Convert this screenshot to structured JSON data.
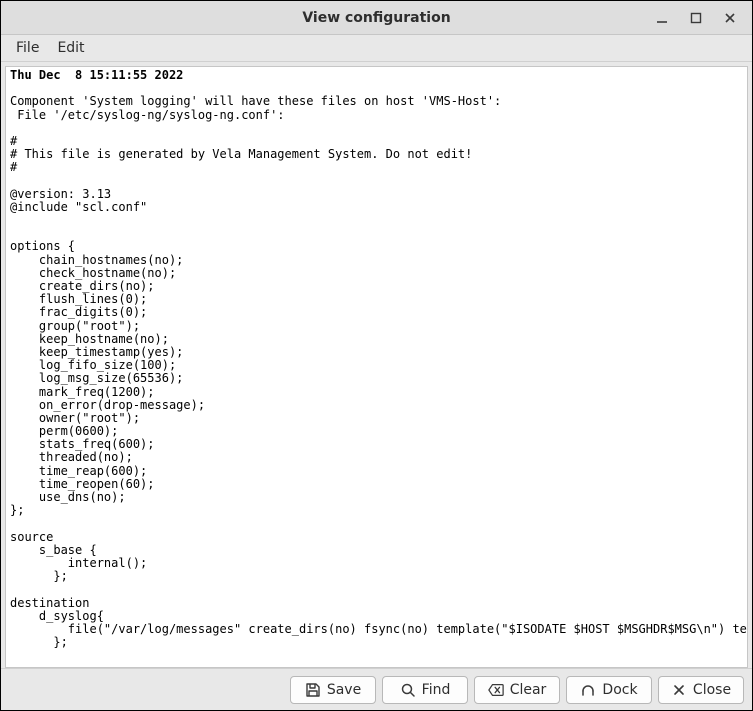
{
  "window": {
    "title": "View configuration"
  },
  "menubar": {
    "file": "File",
    "edit": "Edit"
  },
  "content": {
    "header_line": "Thu Dec  8 15:11:55 2022",
    "body": "\nComponent 'System logging' will have these files on host 'VMS-Host':\n File '/etc/syslog-ng/syslog-ng.conf':\n\n#\n# This file is generated by Vela Management System. Do not edit!\n#\n\n@version: 3.13\n@include \"scl.conf\"\n\n\noptions {\n    chain_hostnames(no);\n    check_hostname(no);\n    create_dirs(no);\n    flush_lines(0);\n    frac_digits(0);\n    group(\"root\");\n    keep_hostname(no);\n    keep_timestamp(yes);\n    log_fifo_size(100);\n    log_msg_size(65536);\n    mark_freq(1200);\n    on_error(drop-message);\n    owner(\"root\");\n    perm(0600);\n    stats_freq(600);\n    threaded(no);\n    time_reap(600);\n    time_reopen(60);\n    use_dns(no);\n};\n\nsource\n    s_base {\n        internal();\n      };\n\ndestination\n    d_syslog{\n        file(\"/var/log/messages\" create_dirs(no) fsync(no) template(\"$ISODATE $HOST $MSGHDR$MSG\\n\") template_escape(no));\n      };\n"
  },
  "footer": {
    "save": "Save",
    "find": "Find",
    "clear": "Clear",
    "dock": "Dock",
    "close": "Close"
  }
}
